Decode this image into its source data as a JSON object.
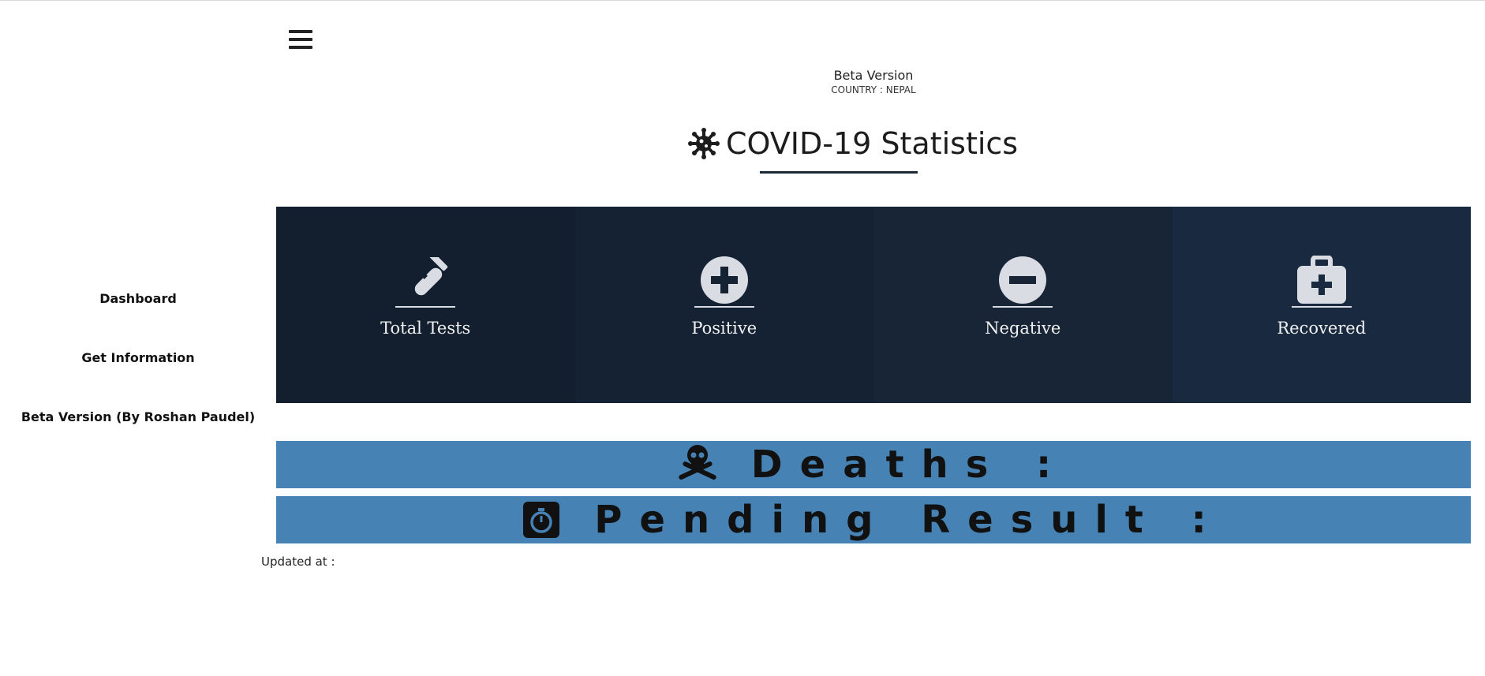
{
  "sidebar": {
    "items": [
      {
        "label": "Dashboard"
      },
      {
        "label": "Get Information"
      },
      {
        "label": "Beta Version (By Roshan Paudel)"
      }
    ]
  },
  "header": {
    "beta_title": "Beta Version",
    "country": "COUNTRY : NEPAL",
    "title": "COVID-19 Statistics"
  },
  "cards": [
    {
      "label": "Total Tests",
      "icon": "test-tube-icon",
      "bg": "#131f2e"
    },
    {
      "label": "Positive",
      "icon": "plus-circle-icon",
      "bg": "#152233"
    },
    {
      "label": "Negative",
      "icon": "minus-circle-icon",
      "bg": "#172537"
    },
    {
      "label": "Recovered",
      "icon": "medical-kit-icon",
      "bg": "#192a40"
    }
  ],
  "bars": {
    "deaths": "Deaths :",
    "pending": "Pending Result :",
    "color": "#4682b4"
  },
  "footer": {
    "updated": "Updated at :"
  }
}
